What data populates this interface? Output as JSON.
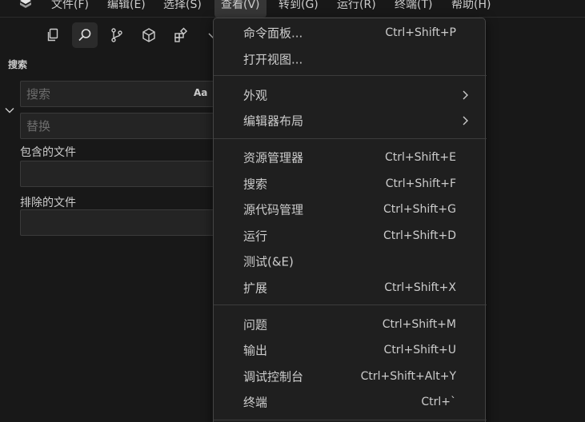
{
  "menubar": {
    "items": [
      "文件(F)",
      "编辑(E)",
      "选择(S)",
      "查看(V)",
      "转到(G)",
      "运行(R)",
      "终端(T)",
      "帮助(H)"
    ]
  },
  "sidebar": {
    "title": "搜索",
    "search": {
      "placeholder": "搜索",
      "case_toggle": "Aa"
    },
    "replace": {
      "placeholder": "替换"
    },
    "include_label": "包含的文件",
    "exclude_label": "排除的文件"
  },
  "view_menu": {
    "groups": [
      [
        {
          "label": "命令面板...",
          "shortcut": "Ctrl+Shift+P"
        },
        {
          "label": "打开视图...",
          "shortcut": ""
        }
      ],
      [
        {
          "label": "外观",
          "submenu": true
        },
        {
          "label": "编辑器布局",
          "submenu": true
        }
      ],
      [
        {
          "label": "资源管理器",
          "shortcut": "Ctrl+Shift+E"
        },
        {
          "label": "搜索",
          "shortcut": "Ctrl+Shift+F"
        },
        {
          "label": "源代码管理",
          "shortcut": "Ctrl+Shift+G"
        },
        {
          "label": "运行",
          "shortcut": "Ctrl+Shift+D"
        },
        {
          "label": "测试(&E)",
          "shortcut": ""
        },
        {
          "label": "扩展",
          "shortcut": "Ctrl+Shift+X"
        }
      ],
      [
        {
          "label": "问题",
          "shortcut": "Ctrl+Shift+M"
        },
        {
          "label": "输出",
          "shortcut": "Ctrl+Shift+U"
        },
        {
          "label": "调试控制台",
          "shortcut": "Ctrl+Shift+Alt+Y"
        },
        {
          "label": "终端",
          "shortcut": "Ctrl+`"
        }
      ]
    ]
  },
  "colors": {
    "background": "#181818",
    "menu_background": "#1f1f1f",
    "text": "#cccccc",
    "placeholder": "#6d6d6d"
  }
}
